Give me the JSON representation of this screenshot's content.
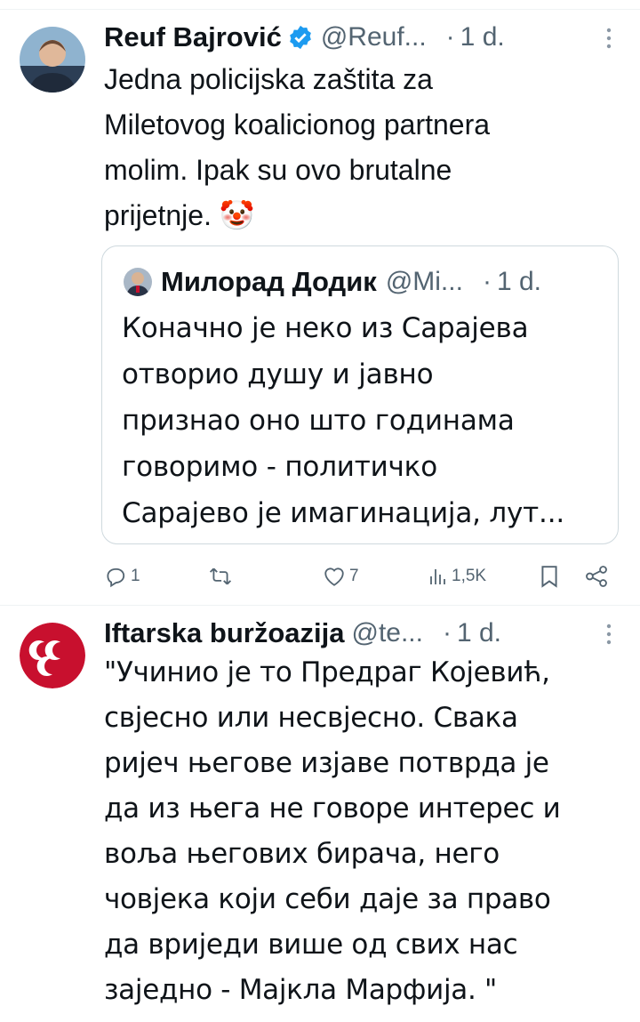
{
  "tweets": [
    {
      "author": "Reuf Bajrović",
      "handle": "@Reuf...",
      "separator": "·",
      "time": "1 d.",
      "text": "Jedna policijska zaštita za\nMiletovog koalicionog partnera\nmolim. Ipak su ovo brutalne\nprijetnje. 🤡",
      "verified": true,
      "quote": {
        "author": "Милорад Додик",
        "handle": "@Mi...",
        "separator": "·",
        "time": "1 d.",
        "text": "Коначно је неко из Сарајева\nотворио душу и јавно\nпризнао оно што годинама\nговоримо - политичко\nСарајево је имагинација, лут..."
      },
      "actions": {
        "replies": "1",
        "retweets": "",
        "likes": "7",
        "views": "1,5K"
      }
    },
    {
      "author": "Iftarska buržoazija",
      "handle": "@te...",
      "separator": "·",
      "time": "1 d.",
      "text": "\"Учинио је то Предраг Којевић,\nсвјесно или несвјесно. Свака\nријеч његове изјаве потврда је\nда из њега не говоре интерес и\nвоља његових бирача, него\nчовјека који себи даје за право\nда вриједи више од свих нас\nзаједно - Мајкла Марфија. \""
    }
  ],
  "icons": {
    "more": "more-vertical-icon",
    "reply": "reply-icon",
    "retweet": "retweet-icon",
    "like": "heart-icon",
    "views": "views-chart-icon",
    "bookmark": "bookmark-icon",
    "share": "share-icon",
    "verified": "verified-badge-icon"
  },
  "colors": {
    "text": "#0f1419",
    "secondary": "#536471",
    "border": "#cfd9de",
    "verified": "#1d9bf0",
    "badge_red": "#c8102e"
  }
}
